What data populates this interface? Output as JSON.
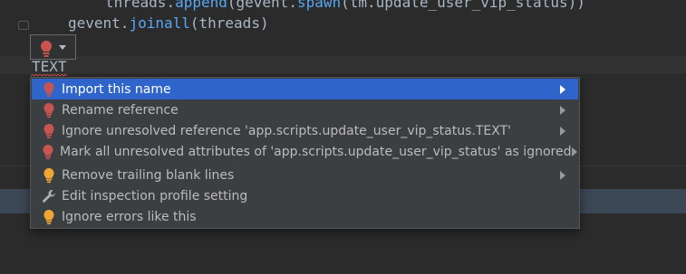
{
  "editor": {
    "line1": {
      "obj": "threads",
      "dot": ".",
      "method": "append",
      "open": "(",
      "obj2": "gevent",
      "dot2": ".",
      "method2": "spawn",
      "open2": "(",
      "arg": "tm.update_user_vip_status",
      "close": "))"
    },
    "line2": {
      "obj": "gevent",
      "dot": ".",
      "method": "joinall",
      "open": "(",
      "arg": "threads",
      "close": ")"
    },
    "token": "TEXT"
  },
  "popup": {
    "items": [
      {
        "label": "Import this name",
        "icon": "red-bulb-icon",
        "has_submenu": true,
        "selected": true
      },
      {
        "label": "Rename reference",
        "icon": "red-bulb-icon",
        "has_submenu": true,
        "selected": false
      },
      {
        "label": "Ignore unresolved reference 'app.scripts.update_user_vip_status.TEXT'",
        "icon": "red-bulb-icon",
        "has_submenu": true,
        "selected": false
      },
      {
        "label": "Mark all unresolved attributes of 'app.scripts.update_user_vip_status' as ignored",
        "icon": "red-bulb-icon",
        "has_submenu": true,
        "selected": false
      },
      {
        "label": "Remove trailing blank lines",
        "icon": "yellow-bulb-icon",
        "has_submenu": true,
        "selected": false
      },
      {
        "label": "Edit inspection profile setting",
        "icon": "wrench-icon",
        "has_submenu": false,
        "selected": false
      },
      {
        "label": "Ignore errors like this",
        "icon": "yellow-bulb-icon",
        "has_submenu": false,
        "selected": false
      }
    ]
  },
  "colors": {
    "background": "#2b2b2b",
    "popup_bg": "#3c3f41",
    "selection": "#2f65ca",
    "error_bulb": "#c75450",
    "warning_bulb": "#f0a732"
  }
}
